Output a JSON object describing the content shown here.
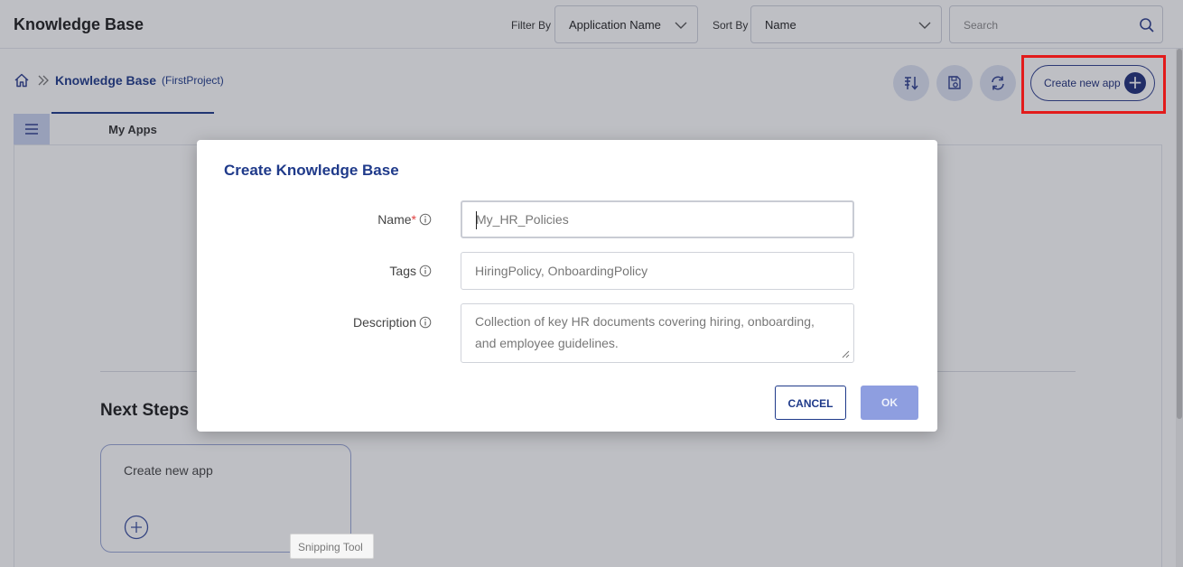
{
  "header": {
    "title": "Knowledge Base",
    "filter_label": "Filter By",
    "filter_value": "Application Name",
    "sort_label": "Sort By",
    "sort_value": "Name",
    "search_placeholder": "Search"
  },
  "breadcrumb": {
    "home_icon": "home-icon",
    "title": "Knowledge Base",
    "project": "(FirstProject)"
  },
  "toolbar": {
    "sort_icon": "sort-descending-icon",
    "save_icon": "save-settings-icon",
    "refresh_icon": "refresh-icon",
    "create_label": "Create new app",
    "create_icon": "plus-icon"
  },
  "tabs": [
    {
      "label": "My Apps",
      "active": true
    }
  ],
  "main": {
    "next_steps_heading": "Next Steps",
    "card_label": "Create new app",
    "card_icon": "add-circle-icon"
  },
  "tooltip": "Snipping Tool",
  "dialog": {
    "title": "Create Knowledge Base",
    "fields": {
      "name": {
        "label": "Name",
        "required_marker": "*",
        "value": "My_HR_Policies"
      },
      "tags": {
        "label": "Tags",
        "value": "HiringPolicy, OnboardingPolicy"
      },
      "description": {
        "label": "Description",
        "value_line1": "Collection of key HR documents covering hiring, onboarding,",
        "value_line2": "and employee guidelines."
      }
    },
    "cancel_label": "CANCEL",
    "ok_label": "OK"
  },
  "colors": {
    "brand": "#1f3a8a",
    "highlight": "#e21b1b",
    "ok_disabled": "#8e9ee0"
  }
}
